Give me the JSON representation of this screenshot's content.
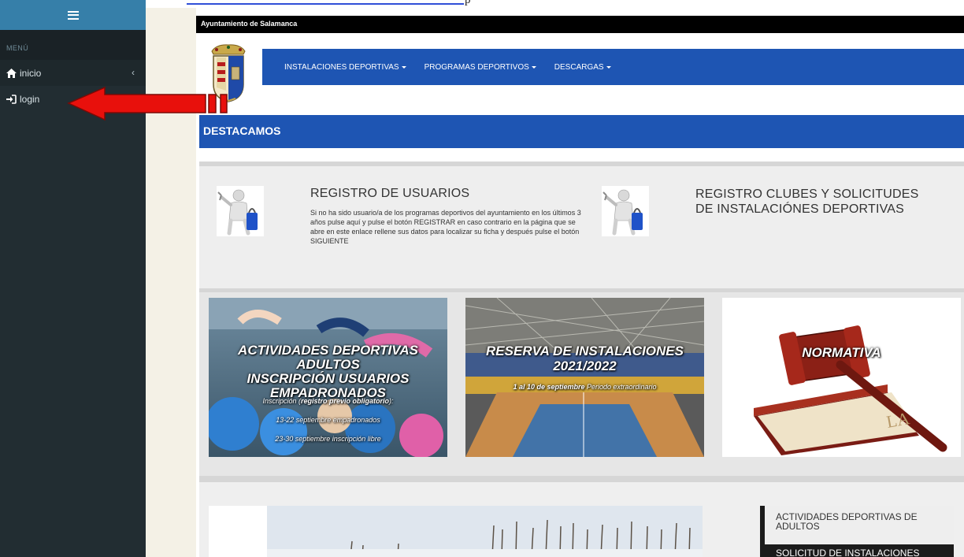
{
  "sidebar": {
    "menu_header": "MENÚ",
    "items": [
      {
        "label": "inicio",
        "icon": "home-icon"
      },
      {
        "label": "login",
        "icon": "sign-in-icon"
      }
    ]
  },
  "site": {
    "topbar_title": "Ayuntamiento de Salamanca",
    "nav": [
      {
        "label": "INSTALACIONES DEPORTIVAS"
      },
      {
        "label": "PROGRAMAS DEPORTIVOS"
      },
      {
        "label": "DESCARGAS"
      }
    ],
    "featured_title": "DESTACAMOS"
  },
  "registro": {
    "usuarios_title": "REGISTRO DE USUARIOS",
    "usuarios_desc": "Si no ha sido usuario/a de los programas deportivos del ayuntamiento en los últimos 3 años pulse aquí y pulse el botón REGISTRAR en caso contrario en la página que se abre en este enlace rellene sus datos para localizar su ficha y después pulse el botón SIGUIENTE",
    "clubes_title_line1": "REGISTRO CLUBES Y SOLICITUDES",
    "clubes_title_line2": "DE INSTALACIÓNES DEPORTIVAS"
  },
  "tiles": {
    "adultos": {
      "line1": "ACTIVIDADES DEPORTIVAS ADULTOS",
      "line2": "INSCRIPCIÓN USUARIOS",
      "line3": "EMPADRONADOS",
      "line4_prefix": "Inscripción (",
      "line4_bold": "registro previo obligatorio",
      "line4_suffix": "):",
      "line5": "13-22 septiembre empadronados",
      "line6": "23-30 septiembre inscripción libre"
    },
    "reserva": {
      "line1": "RESERVA DE INSTALACIONES",
      "line2": "2021/2022",
      "line3_bold": "1 al 10 de septiembre",
      "line3_rest": " Periodo extraordinario"
    },
    "normativa": {
      "title": "NORMATIVA",
      "book_text": "LA"
    }
  },
  "side_list": {
    "item1": "ACTIVIDADES DEPORTIVAS DE ADULTOS",
    "item2": "SOLICITUD DE INSTALACIONES"
  },
  "colors": {
    "sidebar_bg": "#222d32",
    "sidebar_head": "#367fa9",
    "brand_blue": "#1e55b3",
    "arrow_red": "#e8100c"
  }
}
